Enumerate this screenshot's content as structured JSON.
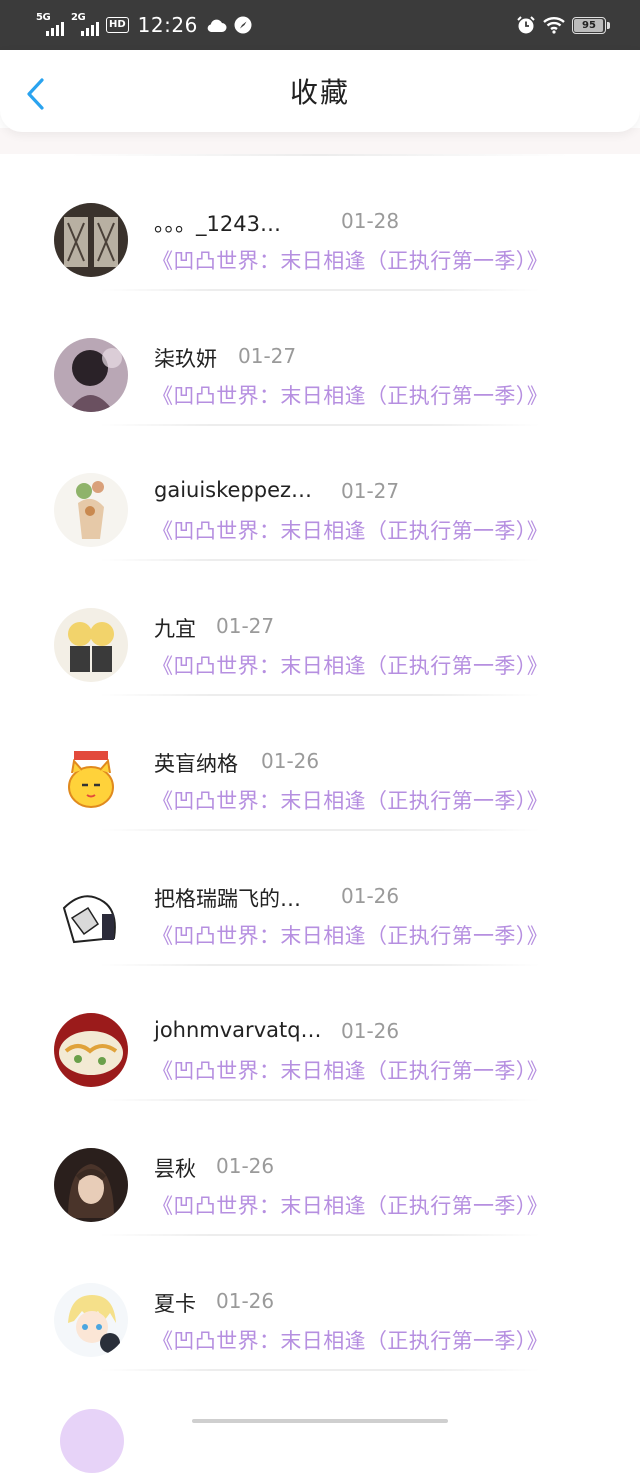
{
  "status_bar": {
    "signal1_tag": "5G",
    "signal2_tag": "2G",
    "hd": "HD",
    "time": "12:26",
    "battery": "95"
  },
  "header": {
    "title": "收藏"
  },
  "favorites": [
    {
      "name": "。。。_1243…",
      "date": "01-28",
      "book": "《凹凸世界：末日相逢（正执行第一季）》",
      "avatar_icon": "user-avatar"
    },
    {
      "name": "柒玖妍",
      "date": "01-27",
      "book": "《凹凸世界：末日相逢（正执行第一季）》",
      "avatar_icon": "user-avatar"
    },
    {
      "name": "gaiuiskeppez…",
      "date": "01-27",
      "book": "《凹凸世界：末日相逢（正执行第一季）》",
      "avatar_icon": "user-avatar"
    },
    {
      "name": "九宜",
      "date": "01-27",
      "book": "《凹凸世界：末日相逢（正执行第一季）》",
      "avatar_icon": "user-avatar"
    },
    {
      "name": "英盲纳格",
      "date": "01-26",
      "book": "《凹凸世界：末日相逢（正执行第一季）》",
      "avatar_icon": "user-avatar"
    },
    {
      "name": "把格瑞踹飞的…",
      "date": "01-26",
      "book": "《凹凸世界：末日相逢（正执行第一季）》",
      "avatar_icon": "user-avatar"
    },
    {
      "name": "johnmvarvatq…",
      "date": "01-26",
      "book": "《凹凸世界：末日相逢（正执行第一季）》",
      "avatar_icon": "user-avatar"
    },
    {
      "name": "昙秋",
      "date": "01-26",
      "book": "《凹凸世界：末日相逢（正执行第一季）》",
      "avatar_icon": "user-avatar"
    },
    {
      "name": "夏卡",
      "date": "01-26",
      "book": "《凹凸世界：末日相逢（正执行第一季）》",
      "avatar_icon": "user-avatar"
    }
  ],
  "colors": {
    "accent_back": "#2aa3ef",
    "book_link": "#b68fe0",
    "status_bar_bg": "#3b3b3b"
  }
}
